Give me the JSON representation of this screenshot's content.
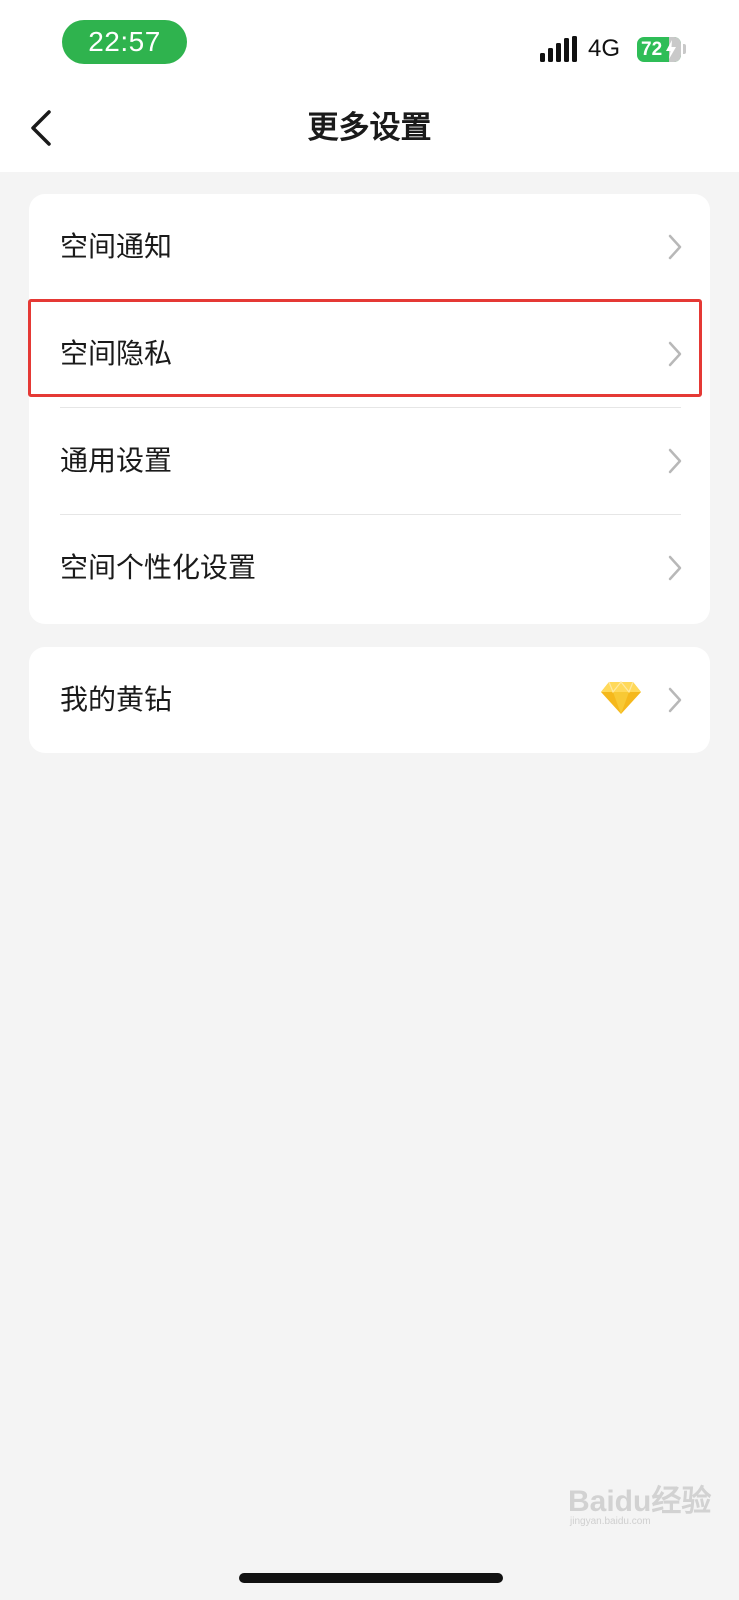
{
  "status_bar": {
    "time": "22:57",
    "network": "4G",
    "battery_level": 72,
    "battery_text": "72",
    "icons": [
      "signal-icon",
      "battery-icon",
      "charging-bolt-icon"
    ],
    "time_pill_color": "#2fb34e",
    "battery_color": "#2fbd57"
  },
  "nav": {
    "title": "更多设置",
    "back_icon": "chevron-left-icon"
  },
  "settings_group": {
    "items": [
      {
        "label": "空间通知",
        "icon": "chevron-right-icon"
      },
      {
        "label": "空间隐私",
        "icon": "chevron-right-icon",
        "highlighted": true
      },
      {
        "label": "通用设置",
        "icon": "chevron-right-icon"
      },
      {
        "label": "空间个性化设置",
        "icon": "chevron-right-icon"
      }
    ]
  },
  "vip_group": {
    "label": "我的黄钻",
    "badge_icon": "yellow-diamond-icon",
    "icon": "chevron-right-icon"
  },
  "annotation": {
    "highlight_color": "#e53935"
  },
  "watermark": {
    "text": "Baidu经验",
    "sub": "jingyan.baidu.com"
  },
  "colors": {
    "page_background": "#f4f4f4",
    "card_background": "#ffffff",
    "text": "#1a1a1a",
    "chevron": "#b8b8b8",
    "diamond": "#f5b81c"
  }
}
